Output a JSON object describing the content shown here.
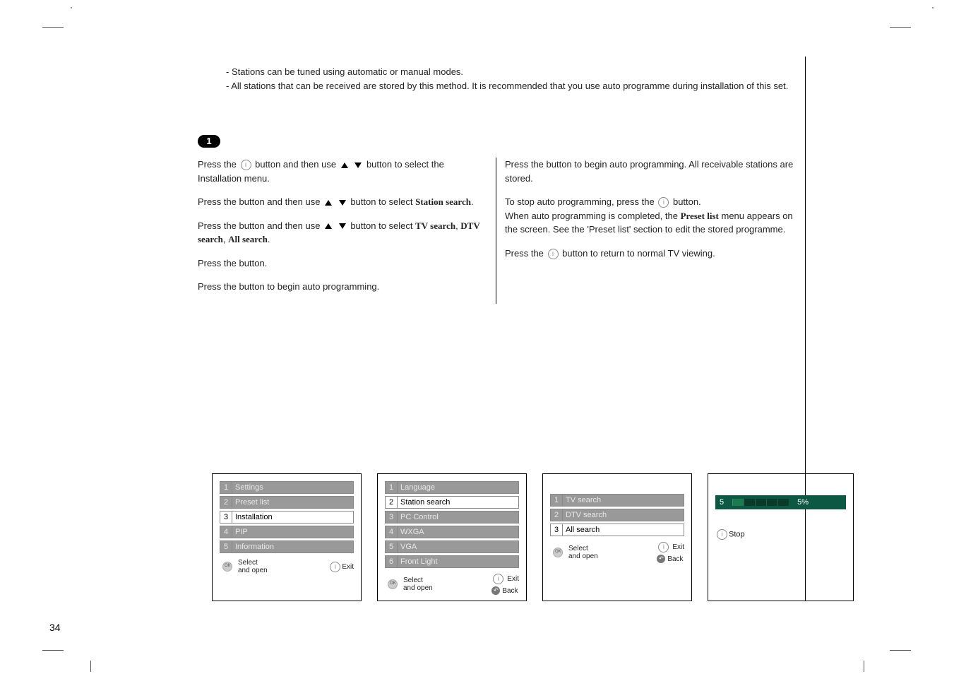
{
  "intro": {
    "line1": "Stations can be tuned using automatic or manual modes.",
    "line2": "All stations that can be received are stored by this method. It is recommended that you use auto programme during installation of this set."
  },
  "badge": "1",
  "left": {
    "p1a": "Press the ",
    "p1b": " button and then use ",
    "p1c": " button to select the Installation menu.",
    "p2a": "Press the        button and then use ",
    "p2c": " button to select ",
    "ss": "Station search",
    "dot": ".",
    "p3a": "Press the        button and then use ",
    "p3c": " button to select ",
    "tv": "TV search",
    "c1": ", ",
    "dtv": "DTV search",
    "c2": ", ",
    "all": "All search",
    "p4": "Press the        button.",
    "p5": "Press the        button to begin auto programming."
  },
  "right": {
    "p1": "Press the        button to begin auto programming. All receivable stations are stored.",
    "p2a": "To stop auto programming, press the ",
    "p2b": " button.",
    "p3a": "When auto programming is completed, the ",
    "pl": "Preset list",
    "p3b": " menu appears on the screen. See the 'Preset list' section to edit the stored programme.",
    "p4a": "Press the ",
    "p4b": " button to return to normal TV viewing."
  },
  "menus": {
    "box1": {
      "items": [
        {
          "n": "1",
          "label": "Settings",
          "dim": true
        },
        {
          "n": "2",
          "label": "Preset list",
          "dim": true
        },
        {
          "n": "3",
          "label": "Installation",
          "dim": false
        },
        {
          "n": "4",
          "label": "PIP",
          "dim": true
        },
        {
          "n": "5",
          "label": "Information",
          "dim": true
        }
      ],
      "foot_sel": "Select",
      "foot_open": "and open",
      "foot_exit": "Exit"
    },
    "box2": {
      "items": [
        {
          "n": "1",
          "label": "Language",
          "dim": true
        },
        {
          "n": "2",
          "label": "Station search",
          "dim": false
        },
        {
          "n": "3",
          "label": "PC Control",
          "dim": true
        },
        {
          "n": "4",
          "label": "WXGA",
          "dim": true
        },
        {
          "n": "5",
          "label": "VGA",
          "dim": true
        },
        {
          "n": "6",
          "label": "Front Light",
          "dim": true
        }
      ],
      "foot_sel": "Select",
      "foot_open": "and open",
      "foot_exit": "Exit",
      "foot_back": "Back"
    },
    "box3": {
      "items": [
        {
          "n": "1",
          "label": "TV search",
          "dim": true
        },
        {
          "n": "2",
          "label": "DTV search",
          "dim": true
        },
        {
          "n": "3",
          "label": "All search",
          "dim": false
        }
      ],
      "foot_sel": "Select",
      "foot_open": "and open",
      "foot_exit": "Exit",
      "foot_back": "Back"
    },
    "box4": {
      "num": "5",
      "pct": "5%",
      "stop": "Stop"
    }
  },
  "page_number": "34"
}
